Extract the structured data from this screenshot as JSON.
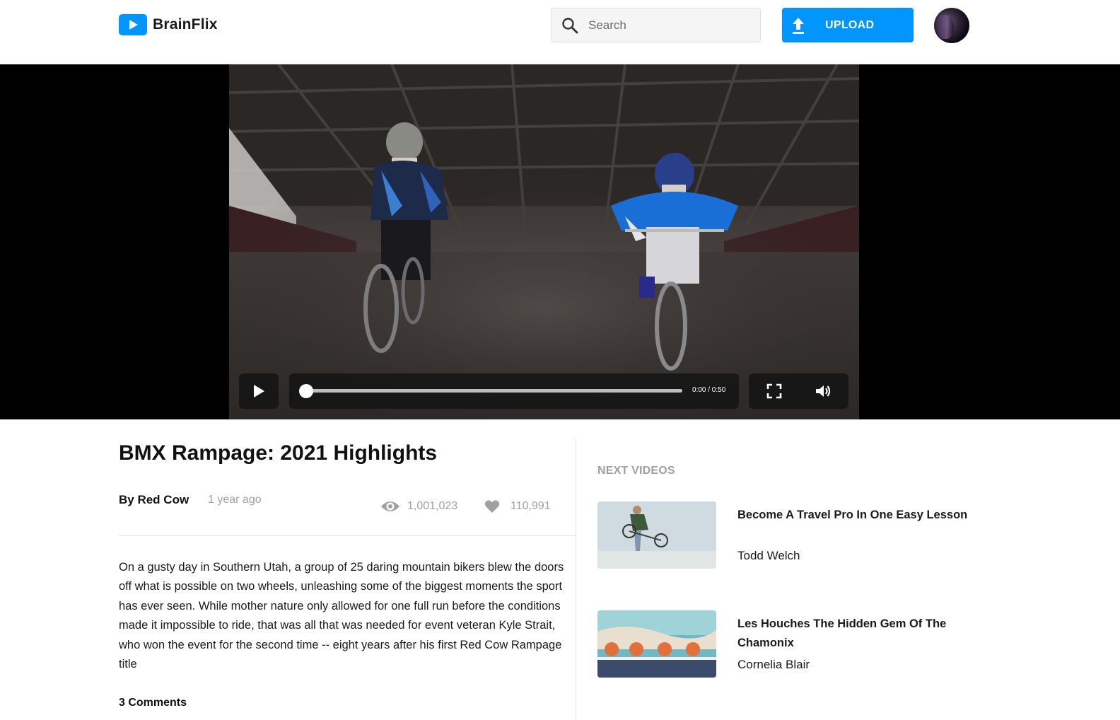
{
  "header": {
    "brand": "BrainFlix",
    "search_placeholder": "Search",
    "upload_label": "UPLOAD",
    "brand_color": "#0095ff"
  },
  "player": {
    "time": "0:00 / 0:50",
    "progress": 0
  },
  "video": {
    "title": "BMX Rampage: 2021 Highlights",
    "channel": "By Red Cow",
    "date": "1 year ago",
    "views": "1,001,023",
    "likes": "110,991",
    "description": "On a gusty day in Southern Utah, a group of 25 daring mountain bikers blew the doors off what is possible on two wheels, unleashing some of the biggest moments the sport has ever seen. While mother nature only allowed for one full run before the conditions made it impossible to ride, that was all that was needed for event veteran Kyle Strait, who won the event for the second time -- eight years after his first Red Cow Rampage title",
    "comments_count": "3 Comments"
  },
  "next_videos": {
    "heading": "NEXT VIDEOS",
    "items": [
      {
        "title": "Become A Travel Pro In One Easy Lesson",
        "channel": "Todd Welch"
      },
      {
        "title": "Les Houches The Hidden Gem Of The Chamonix",
        "channel": "Cornelia Blair"
      }
    ]
  },
  "icons": {
    "logo": "play-logo-icon",
    "search": "search-icon",
    "upload": "upload-icon",
    "play": "play-icon",
    "fullscreen": "fullscreen-icon",
    "volume": "volume-icon",
    "views": "eye-icon",
    "likes": "heart-icon"
  }
}
